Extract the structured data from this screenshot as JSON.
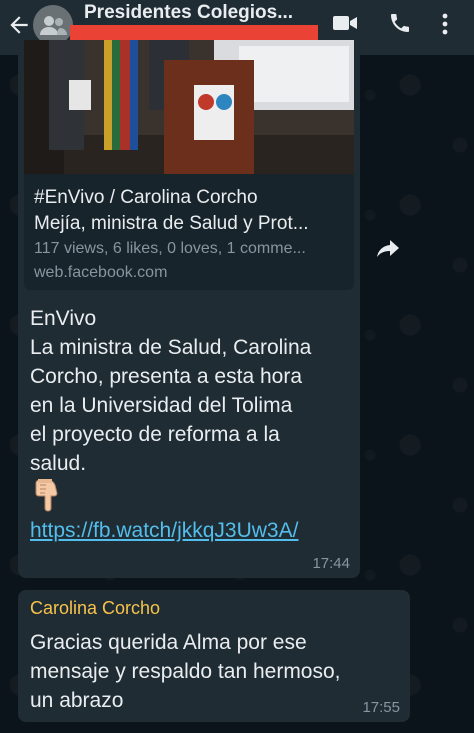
{
  "header": {
    "group_name": "Presidentes Colegios...",
    "participants_redacted": true
  },
  "message_1": {
    "preview": {
      "title_line_1": "#EnVivo / Carolina Corcho",
      "title_line_2": "Mejía, ministra de Salud y Prot...",
      "stats": "117 views, 6 likes, 0 loves, 1 comme...",
      "domain": "web.facebook.com"
    },
    "text_lines": [
      "EnVivo",
      "La ministra de Salud, Carolina",
      "Corcho, presenta a esta hora",
      "en la Universidad del Tolima",
      "el proyecto de reforma a la",
      "salud."
    ],
    "emoji": "👇🏻",
    "link": "https://fb.watch/jkkqJ3Uw3A/",
    "time": "17:44"
  },
  "message_2": {
    "sender": "Carolina Corcho",
    "text_lines": [
      "Gracias querida Alma por ese",
      "mensaje y respaldo tan hermoso,",
      "un abrazo"
    ],
    "time": "17:55"
  },
  "colors": {
    "header_bg": "#1f2c34",
    "chat_bg": "#0b141a",
    "bubble_bg": "#1f2c34",
    "link": "#53bdeb",
    "sender_name": "#f7c34a",
    "redaction": "#ea4335"
  },
  "icons": [
    "back-arrow-icon",
    "group-avatar-icon",
    "video-call-icon",
    "phone-icon",
    "more-options-icon",
    "forward-icon"
  ]
}
